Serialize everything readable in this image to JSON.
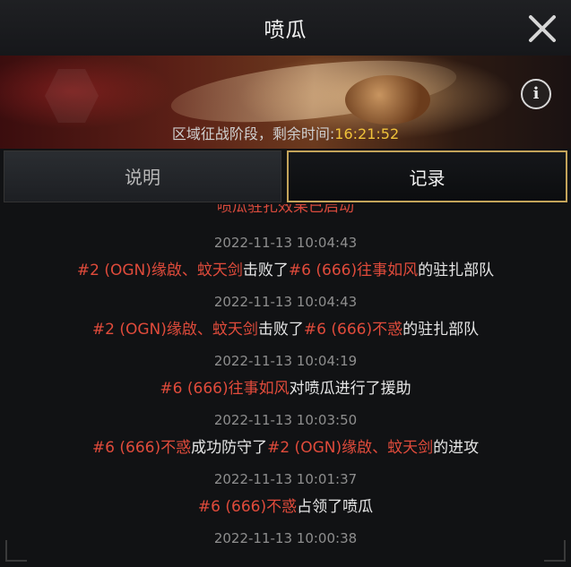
{
  "header": {
    "title": "喷瓜",
    "close_icon": "close-icon"
  },
  "banner": {
    "phase_label": "区域征战阶段，剩余时间:",
    "timer": "16:21:52",
    "info_icon": "info-icon",
    "info_glyph": "i"
  },
  "tabs": {
    "explain_label": "说明",
    "record_label": "记录",
    "active": "记录"
  },
  "colors": {
    "accent_gold": "#c4a45a",
    "timer_yellow": "#f0c23a",
    "highlight_red": "#e04b3b",
    "timestamp_gray": "#8e8e8e"
  },
  "log": {
    "cut_top_text": "喷瓜驻扎效果已启动",
    "entries": [
      {
        "time": "2022-11-13 10:04:43",
        "p1": "#2 (OGN)缘啟、蚊天剑",
        "t1": "击败了",
        "p2": "#6 (666)往事如风",
        "t2": "的驻扎部队"
      },
      {
        "time": "2022-11-13 10:04:43",
        "p1": "#2 (OGN)缘啟、蚊天剑",
        "t1": "击败了",
        "p2": "#6 (666)不惑",
        "t2": "的驻扎部队"
      },
      {
        "time": "2022-11-13 10:04:19",
        "p1": "#6 (666)往事如风",
        "t1": "对喷瓜进行了援助",
        "p2": "",
        "t2": ""
      },
      {
        "time": "2022-11-13 10:03:50",
        "p1": "#6 (666)不惑",
        "t1": "成功防守了",
        "p2": "#2 (OGN)缘啟、蚊天剑",
        "t2": "的进攻"
      },
      {
        "time": "2022-11-13 10:01:37",
        "p1": "#6 (666)不惑",
        "t1": "占领了喷瓜",
        "p2": "",
        "t2": ""
      },
      {
        "time": "2022-11-13 10:00:38",
        "p1": "",
        "t1": "",
        "p2": "",
        "t2": ""
      }
    ]
  }
}
